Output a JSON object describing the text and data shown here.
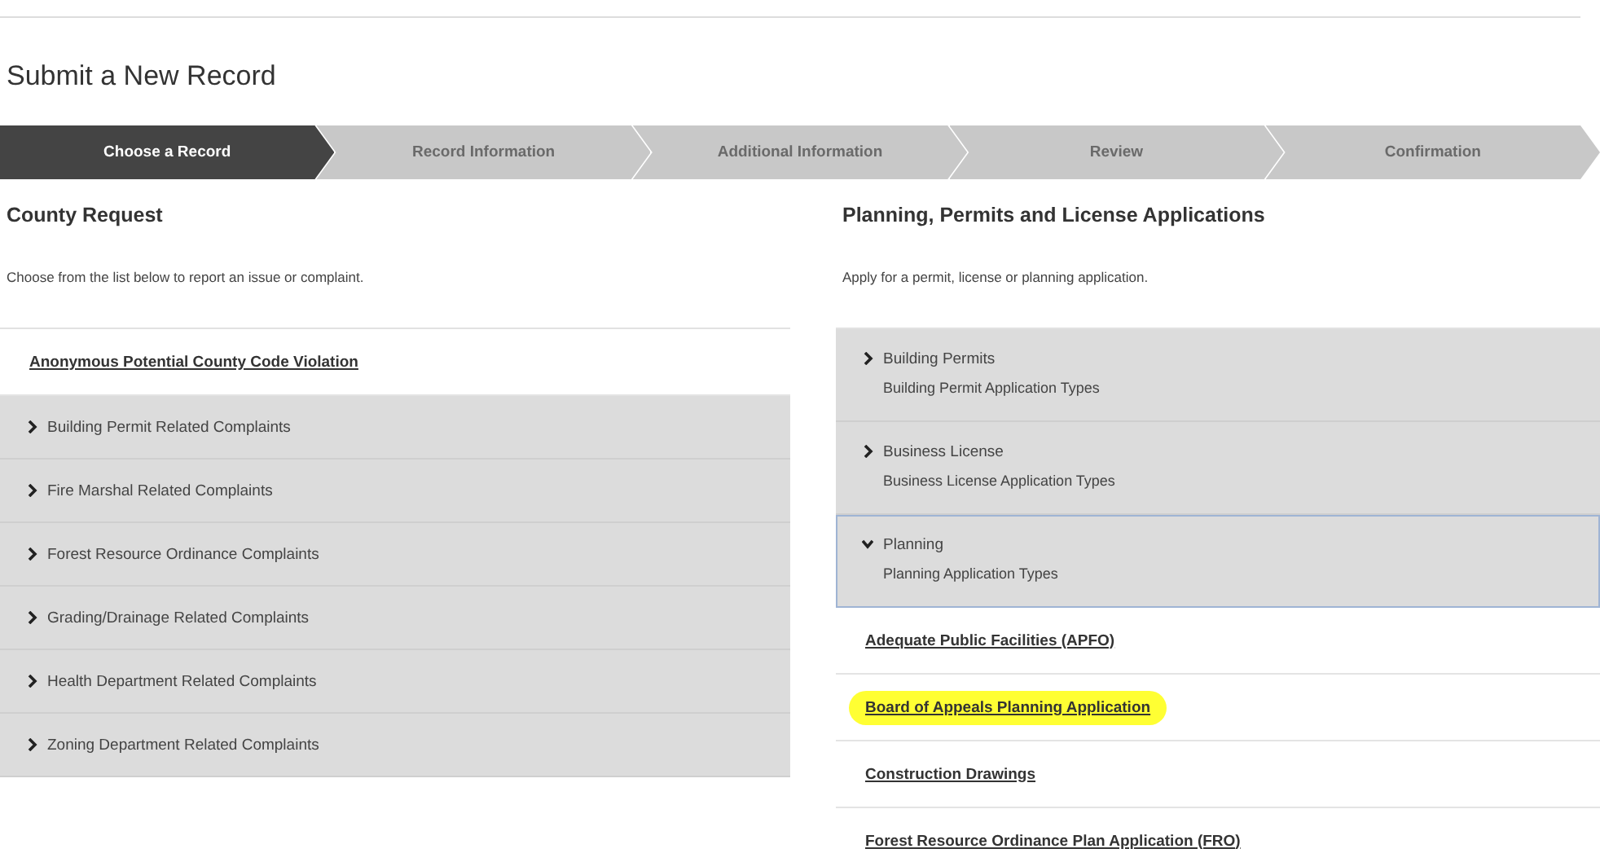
{
  "page_title": "Submit a New Record",
  "steps": [
    {
      "label": "Choose a Record",
      "selected": true
    },
    {
      "label": "Record Information",
      "selected": false
    },
    {
      "label": "Additional Information",
      "selected": false
    },
    {
      "label": "Review",
      "selected": false
    },
    {
      "label": "Confirmation",
      "selected": false
    }
  ],
  "left": {
    "heading": "County Request",
    "description": "Choose from the list below to report an issue or complaint.",
    "items": [
      {
        "kind": "link",
        "label": "Anonymous Potential County Code Violation",
        "highlighted": false
      },
      {
        "kind": "group",
        "label": "Building Permit Related Complaints",
        "expanded": false
      },
      {
        "kind": "group",
        "label": "Fire Marshal Related Complaints",
        "expanded": false
      },
      {
        "kind": "group",
        "label": "Forest Resource Ordinance Complaints",
        "expanded": false
      },
      {
        "kind": "group",
        "label": "Grading/Drainage Related Complaints",
        "expanded": false
      },
      {
        "kind": "group",
        "label": "Health Department Related Complaints",
        "expanded": false
      },
      {
        "kind": "group",
        "label": "Zoning Department Related Complaints",
        "expanded": false
      }
    ]
  },
  "right": {
    "heading": "Planning, Permits and License Applications",
    "description": "Apply for a permit, license or planning application.",
    "items": [
      {
        "kind": "group",
        "label": "Building Permits",
        "sublabel": "Building Permit Application Types",
        "expanded": false
      },
      {
        "kind": "group",
        "label": "Business License",
        "sublabel": "Business License Application Types",
        "expanded": false
      },
      {
        "kind": "group",
        "label": "Planning",
        "sublabel": "Planning Application Types",
        "expanded": true
      },
      {
        "kind": "link",
        "label": "Adequate Public Facilities (APFO)",
        "highlighted": false
      },
      {
        "kind": "link",
        "label": "Board of Appeals Planning Application",
        "highlighted": true
      },
      {
        "kind": "link",
        "label": "Construction Drawings",
        "highlighted": false
      },
      {
        "kind": "link",
        "label": "Forest Resource Ordinance Plan Application (FRO)",
        "highlighted": false
      }
    ]
  }
}
